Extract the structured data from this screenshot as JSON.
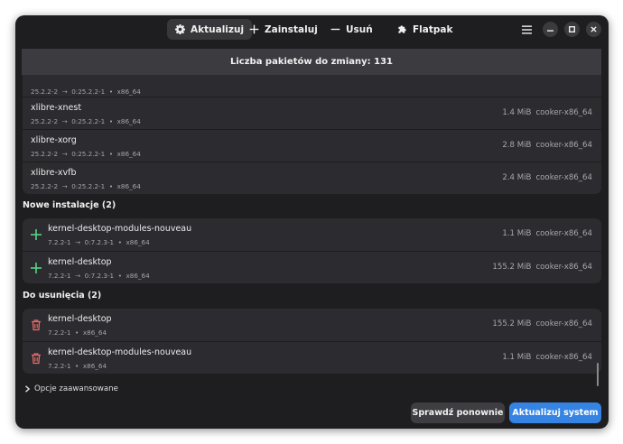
{
  "tabs": [
    {
      "label": "Aktualizuj",
      "icon": "gear-icon",
      "active": true
    },
    {
      "label": "Zainstaluj",
      "icon": "plus-icon",
      "active": false
    },
    {
      "label": "Usuń",
      "icon": "minus-icon",
      "active": false
    },
    {
      "label": "Flatpak",
      "icon": "puzzle-icon",
      "active": false
    }
  ],
  "window_controls": [
    "menu-icon",
    "minimize-icon",
    "maximize-icon",
    "close-icon"
  ],
  "banner": {
    "text": "Liczba pakietów do zmiany: 131"
  },
  "updates": {
    "partial_row": {
      "from": "25.2.2-2",
      "to": "0:25.2.2-1",
      "arch": "x86_64"
    },
    "items": [
      {
        "name": "xlibre-xnest",
        "from": "25.2.2-2",
        "to": "0:25.2.2-1",
        "arch": "x86_64",
        "size": "1.4 MiB",
        "repo": "cooker-x86_64"
      },
      {
        "name": "xlibre-xorg",
        "from": "25.2.2-2",
        "to": "0:25.2.2-1",
        "arch": "x86_64",
        "size": "2.8 MiB",
        "repo": "cooker-x86_64"
      },
      {
        "name": "xlibre-xvfb",
        "from": "25.2.2-2",
        "to": "0:25.2.2-1",
        "arch": "x86_64",
        "size": "2.4 MiB",
        "repo": "cooker-x86_64"
      }
    ]
  },
  "new_installs": {
    "title": "Nowe instalacje (2)",
    "items": [
      {
        "name": "kernel-desktop-modules-nouveau",
        "from": "7.2.2-1",
        "to": "0:7.2.3-1",
        "arch": "x86_64",
        "size": "1.1 MiB",
        "repo": "cooker-x86_64"
      },
      {
        "name": "kernel-desktop",
        "from": "7.2.2-1",
        "to": "0:7.2.3-1",
        "arch": "x86_64",
        "size": "155.2 MiB",
        "repo": "cooker-x86_64"
      }
    ]
  },
  "removals": {
    "title": "Do usunięcia (2)",
    "items": [
      {
        "name": "kernel-desktop",
        "version": "7.2.2-1",
        "arch": "x86_64",
        "size": "155.2 MiB",
        "repo": "cooker-x86_64"
      },
      {
        "name": "kernel-desktop-modules-nouveau",
        "version": "7.2.2-1",
        "arch": "x86_64",
        "size": "1.1 MiB",
        "repo": "cooker-x86_64"
      }
    ]
  },
  "advanced_label": "Opcje zaawansowane",
  "buttons": {
    "check_again": "Sprawdź ponownie",
    "update_system": "Aktualizuj system"
  },
  "colors": {
    "accent": "#3584e4",
    "install": "#57d389",
    "remove": "#e66a6a",
    "background": "#1e1e21",
    "card": "#2c2c30"
  },
  "symbols": {
    "arrow": "→",
    "dot": "•"
  }
}
